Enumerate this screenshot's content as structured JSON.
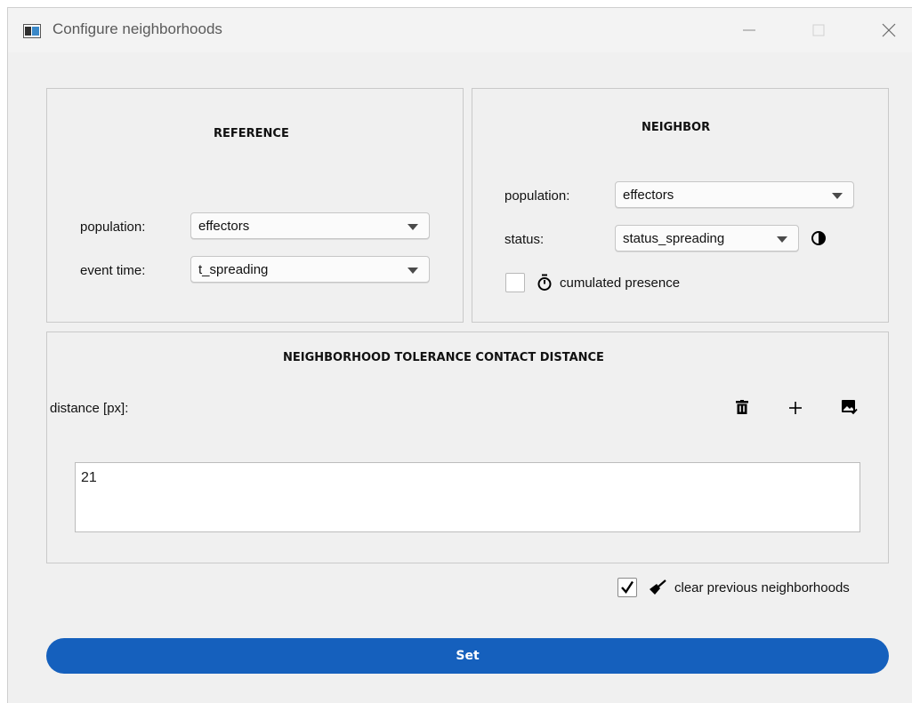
{
  "window": {
    "title": "Configure neighborhoods",
    "icons": [
      "app-window-icon",
      "minimize-icon",
      "maximize-icon",
      "close-icon"
    ]
  },
  "reference": {
    "heading": "REFERENCE",
    "population_label": "population:",
    "population_value": "effectors",
    "event_time_label": "event time:",
    "event_time_value": "t_spreading"
  },
  "neighbor": {
    "heading": "NEIGHBOR",
    "population_label": "population:",
    "population_value": "effectors",
    "status_label": "status:",
    "status_value": "status_spreading",
    "status_icon": "contrast-icon",
    "cumulated_checked": false,
    "cumulated_icon": "timer-icon",
    "cumulated_label": "cumulated presence"
  },
  "distance": {
    "heading": "NEIGHBORHOOD TOLERANCE CONTACT DISTANCE",
    "label": "distance [px]:",
    "toolbar_icons": [
      "trash-icon",
      "add-icon",
      "image-check-icon"
    ],
    "value": "21"
  },
  "clear": {
    "checked": true,
    "icon": "broom-icon",
    "label": "clear previous neighborhoods"
  },
  "set_button": {
    "label": "Set"
  },
  "colors": {
    "accent": "#1560bd",
    "window_bg": "#f0f0f0",
    "border": "#c9c9c9"
  }
}
